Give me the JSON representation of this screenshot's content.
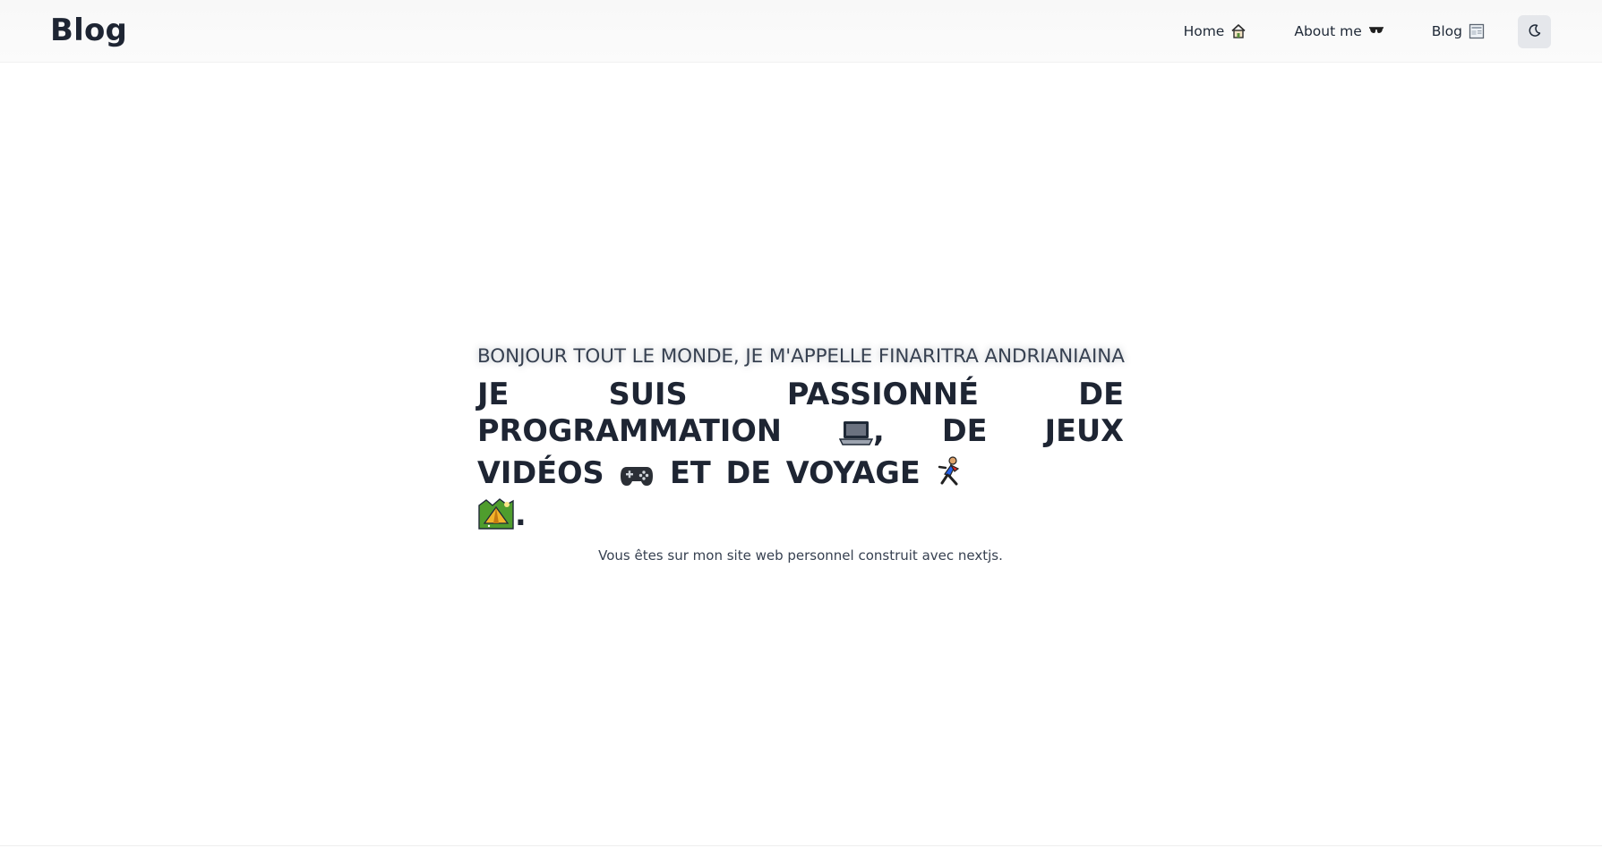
{
  "header": {
    "brand": "Blog",
    "nav": [
      {
        "label": "Home",
        "icon": "house-icon"
      },
      {
        "label": "About me",
        "icon": "sunglasses-icon"
      },
      {
        "label": "Blog",
        "icon": "newspaper-icon"
      }
    ],
    "theme_toggle_icon": "moon-icon"
  },
  "hero": {
    "intro": "BONJOUR TOUT LE MONDE, JE M'APPELLE FINARITRA ANDRIANIAINA",
    "headline": {
      "part1": "Je suis passionné de programmation",
      "part2": ", de jeux vidéos",
      "part3": "et de voyage",
      "part4": "."
    },
    "emojis": [
      "laptop-icon",
      "game-controller-icon",
      "runner-icon",
      "camping-icon"
    ],
    "subtitle": "Vous êtes sur mon site web personnel construit avec nextjs."
  },
  "colors": {
    "text": "#1e2533",
    "header_bg": "#f8f8f8",
    "toggle_bg": "#e5e7eb"
  }
}
